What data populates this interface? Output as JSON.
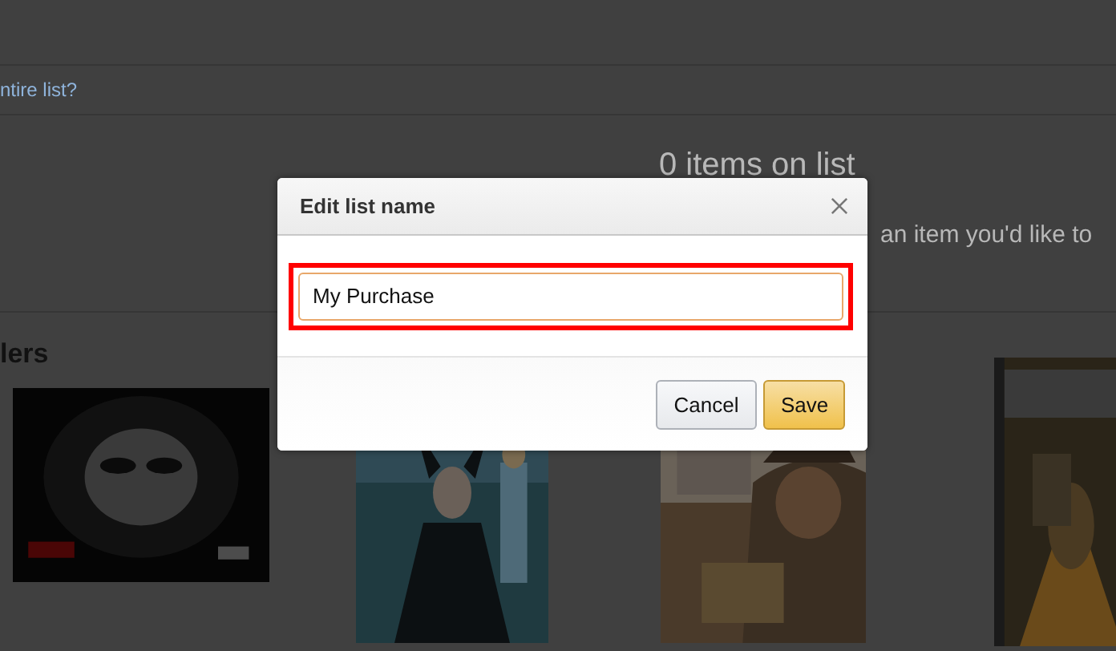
{
  "background": {
    "link": "ntire list?",
    "item_count": "0 items on list",
    "hint": "an item you'd like to",
    "section_heading": "lers"
  },
  "dialog": {
    "title": "Edit list name",
    "input": {
      "value": "My Purchase",
      "highlighted": true
    },
    "buttons": [
      {
        "label": "Cancel",
        "kind": "secondary"
      },
      {
        "label": "Save",
        "kind": "primary"
      }
    ]
  }
}
